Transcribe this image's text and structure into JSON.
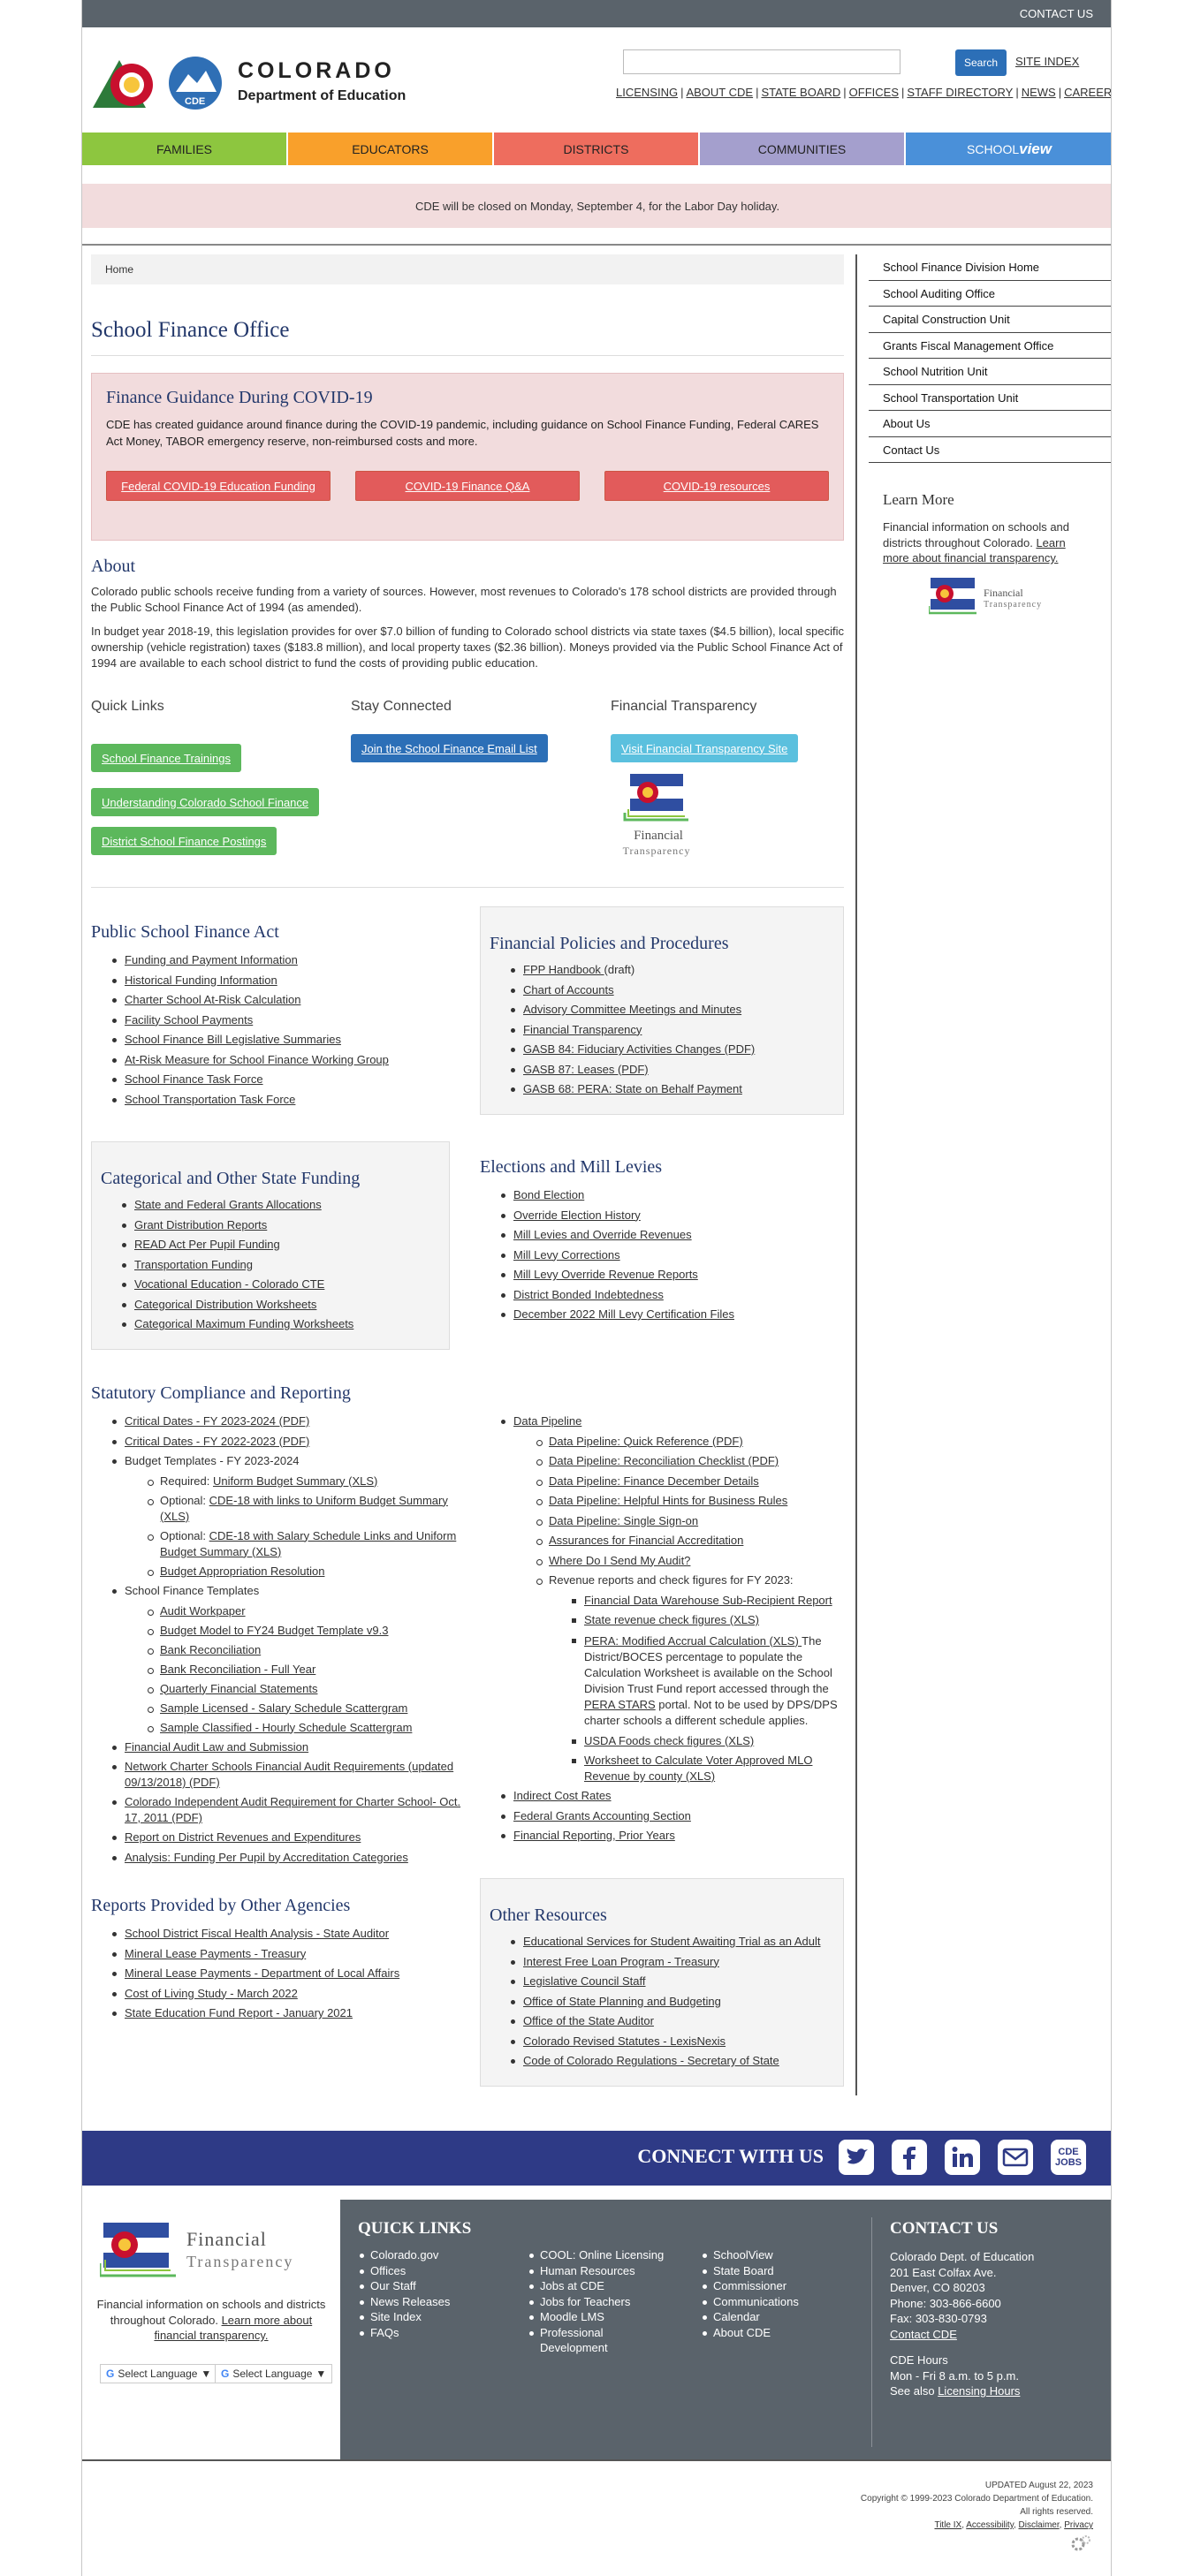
{
  "header": {
    "contact_us": "CONTACT US",
    "org_line1": "COLORADO",
    "org_line2": "Department of Education",
    "cde_badge": "CDE",
    "search_placeholder": "",
    "search_button": "Search",
    "site_index": "SITE INDEX",
    "util_links": [
      "LICENSING",
      "ABOUT CDE",
      "STATE BOARD",
      "OFFICES",
      "STAFF DIRECTORY",
      "NEWS",
      "CAREERS"
    ]
  },
  "nav": {
    "tabs": [
      {
        "label": "FAMILIES",
        "color": "#8dc63f"
      },
      {
        "label": "EDUCATORS",
        "color": "#f9a02b"
      },
      {
        "label": "DISTRICTS",
        "color": "#ee6d5e"
      },
      {
        "label": "COMMUNITIES",
        "color": "#a49fcd"
      },
      {
        "label": "SCHOOLview",
        "color": "#4a90d9"
      }
    ],
    "schoolview_a": "SCHOOL",
    "schoolview_b": "view"
  },
  "alert": "CDE will be closed on Monday, September 4, for the Labor Day holiday.",
  "breadcrumb": "Home",
  "page_title": "School Finance Office",
  "covid": {
    "title": "Finance Guidance During COVID-19",
    "text": "CDE has created guidance around finance during the COVID-19 pandemic, including guidance on School Finance Funding, Federal CARES Act Money, TABOR emergency reserve, non-reimbursed costs and more.",
    "buttons": [
      "Federal COVID-19 Education Funding",
      "COVID-19 Finance Q&A",
      "COVID-19 resources"
    ]
  },
  "about": {
    "title": "About",
    "p1": "Colorado public schools receive funding from a variety of sources. However, most revenues to Colorado's 178 school districts are provided through the Public School Finance Act of 1994 (as amended).",
    "p2": "In budget year 2018-19, this legislation provides for over $7.0 billion of funding to Colorado school districts via state taxes ($4.5 billion), local specific ownership (vehicle registration) taxes ($183.8 million), and local property taxes ($2.36 billion). Moneys provided via the Public School Finance Act of 1994 are available to each school district to fund the costs of providing public education."
  },
  "quick_links": {
    "title": "Quick Links",
    "buttons": [
      "School Finance Trainings",
      "Understanding Colorado School Finance",
      "District School Finance Postings"
    ]
  },
  "stay_connected": {
    "title": "Stay Connected",
    "button": "Join the School Finance Email List"
  },
  "fin_transparency": {
    "title": "Financial Transparency",
    "button": "Visit Financial Transparency Site",
    "logo_line1": "Financial",
    "logo_line2": "Transparency"
  },
  "psfa": {
    "title": "Public School Finance Act",
    "items": [
      "Funding and Payment Information",
      "Historical Funding Information",
      "Charter School At-Risk Calculation",
      "Facility School Payments",
      "School Finance Bill Legislative Summaries",
      "At-Risk Measure for School Finance Working Group",
      "School Finance Task Force",
      "School Transportation Task Force"
    ]
  },
  "policies": {
    "title": "Financial Policies and Procedures",
    "items": [
      "FPP Handbook ",
      "Chart of Accounts",
      "Advisory Committee Meetings and Minutes",
      "Financial Transparency",
      "GASB 84: Fiduciary Activities Changes (PDF)",
      "GASB 87: Leases (PDF)",
      "GASB 68: PERA: State on Behalf Payment"
    ],
    "draft_suffix": "(draft)"
  },
  "categorical": {
    "title": "Categorical and Other State Funding",
    "items": [
      "State and Federal Grants Allocations",
      "Grant Distribution Reports",
      "READ Act Per Pupil Funding",
      "Transportation Funding",
      "Vocational Education - Colorado CTE",
      "Categorical Distribution Worksheets",
      "Categorical Maximum Funding Worksheets"
    ]
  },
  "elections": {
    "title": "Elections and Mill Levies",
    "items": [
      "Bond Election",
      "Override Election History",
      "Mill Levies and Override Revenues",
      "Mill Levy Corrections ",
      "Mill Levy Override Revenue Reports",
      "District Bonded Indebtedness",
      "December 2022 Mill Levy Certification Files"
    ]
  },
  "statutory": {
    "title": "Statutory Compliance and Reporting",
    "left": {
      "critical1": "Critical Dates - FY 2023-2024 (PDF)",
      "critical2": "Critical Dates - FY 2022-2023 (PDF)",
      "budget_templates": "Budget Templates - FY 2023-2024",
      "req_prefix": "Required: ",
      "req_link": "Uniform Budget Summary (XLS)",
      "opt_prefix": "Optional: ",
      "opt1_link": "CDE-18 with links to Uniform Budget Summary (XLS)",
      "opt2_link": "CDE-18 with Salary Schedule Links and Uniform Budget Summary (XLS)",
      "approp": "Budget Appropriation Resolution",
      "sft": "School Finance Templates",
      "sft_items": [
        "Audit Workpaper",
        "Budget Model to FY24 Budget Template v9.3",
        "Bank Reconciliation",
        "Bank Reconciliation - Full Year",
        "Quarterly Financial Statements",
        "Sample Licensed - Salary Schedule  Scattergram",
        "Sample Classified - Hourly Schedule Scattergram"
      ],
      "rest": [
        "Financial Audit Law and Submission",
        "Network Charter Schools Financial Audit Requirements (updated 09/13/2018) (PDF)",
        "Colorado Independent Audit Requirement for Charter School- Oct. 17, 2011 (PDF)",
        "Report on District Revenues and Expenditures",
        "Analysis: Funding Per Pupil by Accreditation Categories"
      ]
    },
    "right": {
      "pipeline": "Data Pipeline",
      "pipeline_items": [
        "Data Pipeline: Quick Reference (PDF)",
        "Data Pipeline: Reconciliation Checklist (PDF)",
        "Data Pipeline: Finance December Details",
        "Data Pipeline: Helpful Hints for Business Rules",
        "Data Pipeline: Single Sign-on",
        "Assurances for Financial Accreditation",
        "Where Do I Send My Audit?"
      ],
      "revenue_label": "Revenue reports and check figures for FY 2023:",
      "rev1": "Financial Data Warehouse Sub-Recipient Report",
      "rev2": "State revenue check figures (XLS)",
      "pera_link": "PERA: Modified Accrual Calculation (XLS) ",
      "pera_text1": " The District/BOCES percentage to populate the Calculation Worksheet is available on the School Division Trust Fund report accessed through the ",
      "pera_stars": "PERA STARS",
      "pera_text2": " portal.  Not to be used by DPS/DPS charter schools a different schedule applies.",
      "rev4": "USDA Foods check figures (XLS)",
      "rev5": "Worksheet to Calculate Voter Approved MLO Revenue by county (XLS)",
      "rest": [
        "Indirect Cost Rates",
        "Federal Grants Accounting Section",
        "Financial Reporting, Prior Years"
      ]
    }
  },
  "other_agencies": {
    "title": "Reports Provided by Other Agencies",
    "items": [
      "School District Fiscal Health Analysis - State Auditor",
      "Mineral Lease Payments - Treasury",
      "Mineral Lease Payments - Department of Local Affairs",
      "Cost of Living Study - March 2022",
      "State Education Fund Report - January 2021"
    ]
  },
  "other_resources": {
    "title": "Other Resources",
    "items": [
      "Educational Services for Student Awaiting Trial as an Adult",
      "Interest Free Loan Program - Treasury",
      "Legislative Council Staff",
      "Office of State Planning and Budgeting",
      "Office of the State Auditor",
      "Colorado Revised Statutes - LexisNexis",
      "Code of Colorado Regulations - Secretary of State"
    ]
  },
  "sidebar": {
    "items": [
      "School Finance Division Home",
      "School Auditing Office",
      "Capital Construction Unit",
      "Grants Fiscal Management Office",
      "School Nutrition Unit",
      "School Transportation Unit",
      "About Us",
      "Contact Us"
    ],
    "learn_more_title": "Learn More",
    "learn_more_text": "Financial information on schools and districts throughout Colorado. ",
    "learn_more_link": "Learn more about financial transparency."
  },
  "connect": {
    "label": "CONNECT WITH US",
    "icons": [
      "twitter-icon",
      "facebook-icon",
      "linkedin-icon",
      "email-icon",
      "cde-jobs-icon"
    ],
    "jobs_a": "CDE",
    "jobs_b": "JOBS"
  },
  "footer": {
    "ft_line1": "Financial",
    "ft_line2": "Transparency",
    "ft_text": "Financial information on schools and districts throughout Colorado. ",
    "ft_link": "Learn more about financial transparency.",
    "lang1": "Select Language",
    "lang2": "Select Language",
    "quick_links_title": "QUICK LINKS",
    "col1": [
      "Colorado.gov",
      "Offices",
      "Our Staff",
      "News Releases",
      "Site Index",
      "FAQs"
    ],
    "col2": [
      "COOL: Online Licensing",
      "Human Resources",
      "Jobs at CDE",
      "Jobs for Teachers",
      "Moodle LMS",
      "Professional Development"
    ],
    "col3": [
      "SchoolView",
      "State Board",
      "Commissioner",
      "Communications",
      "Calendar",
      "About CDE"
    ],
    "contact_title": "CONTACT US",
    "contact_lines": [
      "Colorado Dept. of Education",
      "201 East Colfax Ave.",
      "Denver, CO 80203",
      "Phone: 303-866-6600",
      "Fax: 303-830-0793"
    ],
    "contact_link": "Contact CDE",
    "hours_title": "CDE Hours",
    "hours": "Mon - Fri 8 a.m. to 5 p.m.",
    "see_also": "See also ",
    "licensing_hours": "Licensing Hours"
  },
  "legal": {
    "updated": "UPDATED August 22, 2023",
    "copyright": "Copyright © 1999-2023 Colorado Department of Education.",
    "rights": "All rights reserved.",
    "links": [
      "Title IX",
      "Accessibility",
      "Disclaimer",
      "Privacy"
    ]
  }
}
